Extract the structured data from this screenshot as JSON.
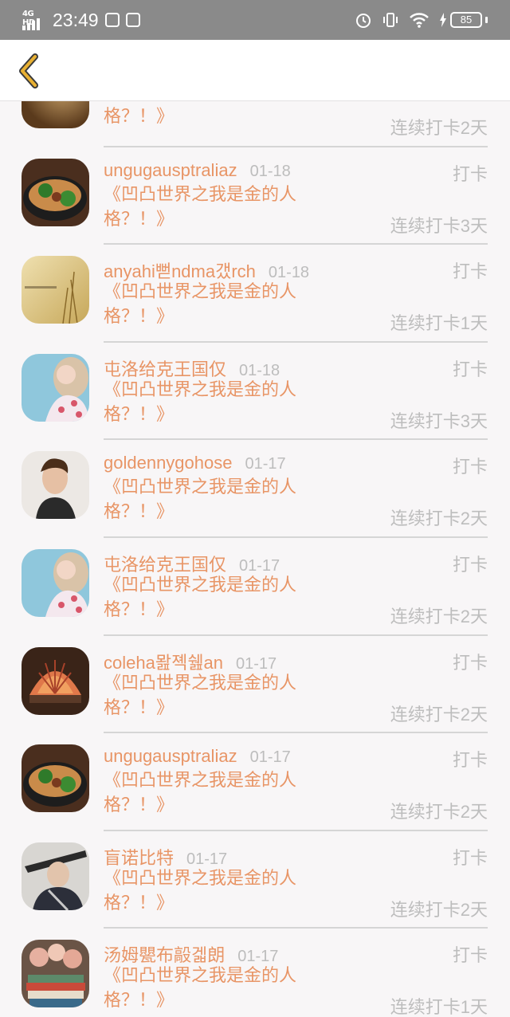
{
  "status_bar": {
    "network": "4G HD",
    "time": "23:49",
    "battery": "85"
  },
  "header": {
    "back_icon": "chevron-left-icon",
    "accent_color": "#e8b032"
  },
  "colors": {
    "accent_text": "#e89566",
    "muted_text": "#bdbdbd"
  },
  "rows": [
    {
      "name": "",
      "date": "",
      "action": "",
      "book": "格？！》",
      "streak": "连续打卡2天",
      "avatar": "food"
    },
    {
      "name": "ungugausptraliaz",
      "date": "01-18",
      "action": "打卡",
      "book": "《凹凸世界之我是金的人格？！》",
      "streak": "连续打卡3天",
      "avatar": "noodles"
    },
    {
      "name": "anyahi뻗ndma갰rch",
      "date": "01-18",
      "action": "打卡",
      "book": "《凹凸世界之我是金的人格？！》",
      "streak": "连续打卡1天",
      "avatar": "grass"
    },
    {
      "name": "屯洛给克王国仅",
      "date": "01-18",
      "action": "打卡",
      "book": "《凹凸世界之我是金的人格？！》",
      "streak": "连续打卡3天",
      "avatar": "girl"
    },
    {
      "name": "goldennygohose",
      "date": "01-17",
      "action": "打卡",
      "book": "《凹凸世界之我是金的人格？！》",
      "streak": "连续打卡2天",
      "avatar": "man"
    },
    {
      "name": "屯洛给克王国仅",
      "date": "01-17",
      "action": "打卡",
      "book": "《凹凸世界之我是金的人格？！》",
      "streak": "连续打卡2天",
      "avatar": "girl"
    },
    {
      "name": "coleha뫒졕쉞an",
      "date": "01-17",
      "action": "打卡",
      "book": "《凹凸世界之我是金的人格？！》",
      "streak": "连续打卡2天",
      "avatar": "shell"
    },
    {
      "name": "ungugausptraliaz",
      "date": "01-17",
      "action": "打卡",
      "book": "《凹凸世界之我是金的人格？！》",
      "streak": "连续打卡2天",
      "avatar": "noodles"
    },
    {
      "name": "盲诺比特",
      "date": "01-17",
      "action": "打卡",
      "book": "《凹凸世界之我是金的人格？！》",
      "streak": "连续打卡2天",
      "avatar": "swordsman"
    },
    {
      "name": "汤姆甖布毃겗朗",
      "date": "01-17",
      "action": "打卡",
      "book": "《凹凸世界之我是金的人格？！》",
      "streak": "连续打卡1天",
      "avatar": "books"
    }
  ]
}
